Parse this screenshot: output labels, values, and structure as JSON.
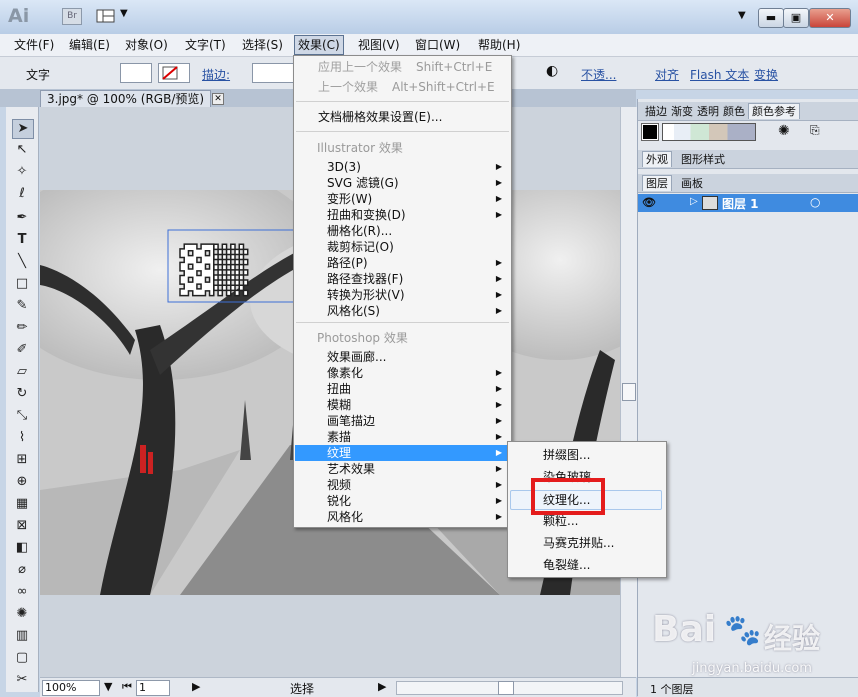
{
  "titlebar": {
    "app_logo": "Ai",
    "bridge_label": "Br",
    "arrange_icon": "layout-grid-icon",
    "dropdown_arrow": "▼",
    "min_label": "▬",
    "max_label": "▣",
    "close_label": "✕"
  },
  "menubar": {
    "items": [
      "文件(F)",
      "编辑(E)",
      "对象(O)",
      "文字(T)",
      "选择(S)",
      "效果(C)",
      "视图(V)",
      "窗口(W)",
      "帮助(H)"
    ]
  },
  "controlbar": {
    "label": "文字",
    "stroke_label": "描边:",
    "opacity_label": "不透...",
    "align_label": "对齐",
    "flash_text_label": "Flash 文本",
    "transform_label": "变换"
  },
  "document": {
    "tab_title": "3.jpg* @ 100% (RGB/预览)",
    "tab_close": "✕"
  },
  "statusbar": {
    "zoom": "100%",
    "page": "1",
    "tool": "选择"
  },
  "effect_menu": {
    "apply_last": "应用上一个效果",
    "apply_last_shortcut": "Shift+Ctrl+E",
    "last_effect": "上一个效果",
    "last_effect_shortcut": "Alt+Shift+Ctrl+E",
    "raster_settings": "文档栅格效果设置(E)...",
    "illustrator_header": "Illustrator 效果",
    "illustrator_items": [
      {
        "label": "3D(3)",
        "submenu": true
      },
      {
        "label": "SVG 滤镜(G)",
        "submenu": true
      },
      {
        "label": "变形(W)",
        "submenu": true
      },
      {
        "label": "扭曲和变换(D)",
        "submenu": true
      },
      {
        "label": "栅格化(R)...",
        "submenu": false
      },
      {
        "label": "裁剪标记(O)",
        "submenu": false
      },
      {
        "label": "路径(P)",
        "submenu": true
      },
      {
        "label": "路径查找器(F)",
        "submenu": true
      },
      {
        "label": "转换为形状(V)",
        "submenu": true
      },
      {
        "label": "风格化(S)",
        "submenu": true
      }
    ],
    "photoshop_header": "Photoshop 效果",
    "photoshop_items": [
      {
        "label": "效果画廊...",
        "submenu": false
      },
      {
        "label": "像素化",
        "submenu": true
      },
      {
        "label": "扭曲",
        "submenu": true
      },
      {
        "label": "模糊",
        "submenu": true
      },
      {
        "label": "画笔描边",
        "submenu": true
      },
      {
        "label": "素描",
        "submenu": true
      },
      {
        "label": "纹理",
        "submenu": true
      },
      {
        "label": "艺术效果",
        "submenu": true
      },
      {
        "label": "视频",
        "submenu": true
      },
      {
        "label": "锐化",
        "submenu": true
      },
      {
        "label": "风格化",
        "submenu": true
      }
    ]
  },
  "texture_submenu": {
    "items": [
      "拼缀图...",
      "染色玻璃...",
      "纹理化...",
      "颗粒...",
      "马赛克拼贴...",
      "龟裂缝..."
    ]
  },
  "panels": {
    "top_tabs": [
      "描边",
      "渐变",
      "透明",
      "颜色",
      "颜色参考"
    ],
    "appearance_tabs": [
      "外观",
      "图形样式"
    ],
    "layers_tabs": [
      "图层",
      "画板"
    ],
    "layer_name": "图层 1",
    "layer_count": "1 个图层"
  },
  "watermark": {
    "brand": "Bai",
    "brand2": "经验",
    "url": "jingyan.baidu.com"
  },
  "colors": {
    "highlight": "#3399ff",
    "callout": "#e41c1c",
    "layer_selected": "#3f8be0"
  }
}
